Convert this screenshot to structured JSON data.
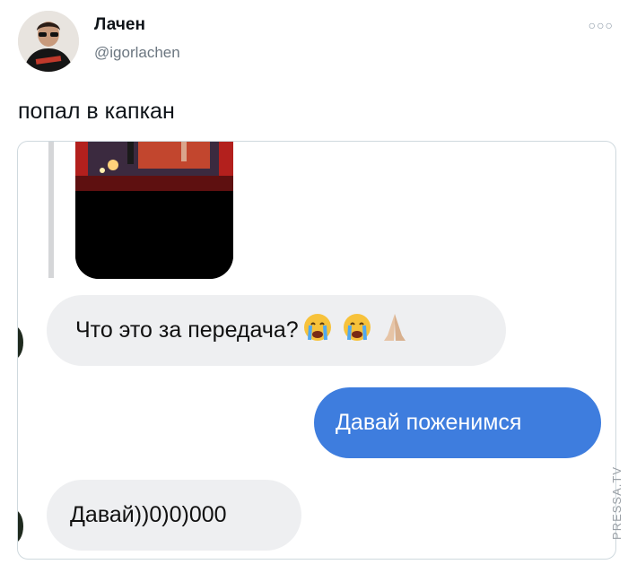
{
  "author": {
    "display_name": "Лачен",
    "handle": "@igorlachen"
  },
  "tweet": {
    "text": "попал в капкан"
  },
  "chat": {
    "messages": [
      {
        "direction": "incoming",
        "text": "Что это за передача?"
      },
      {
        "direction": "outgoing",
        "text": "Давай поженимся"
      },
      {
        "direction": "incoming",
        "text": "Давай))0)0)000"
      }
    ],
    "emoji": [
      "crying-face",
      "crying-face",
      "folded-hands"
    ],
    "colors": {
      "outgoing_bubble": "#3e7dde",
      "incoming_bubble": "#eeeff1"
    }
  },
  "watermark": "PRESSA.TV",
  "icons": {
    "more": "more-dots-icon"
  }
}
